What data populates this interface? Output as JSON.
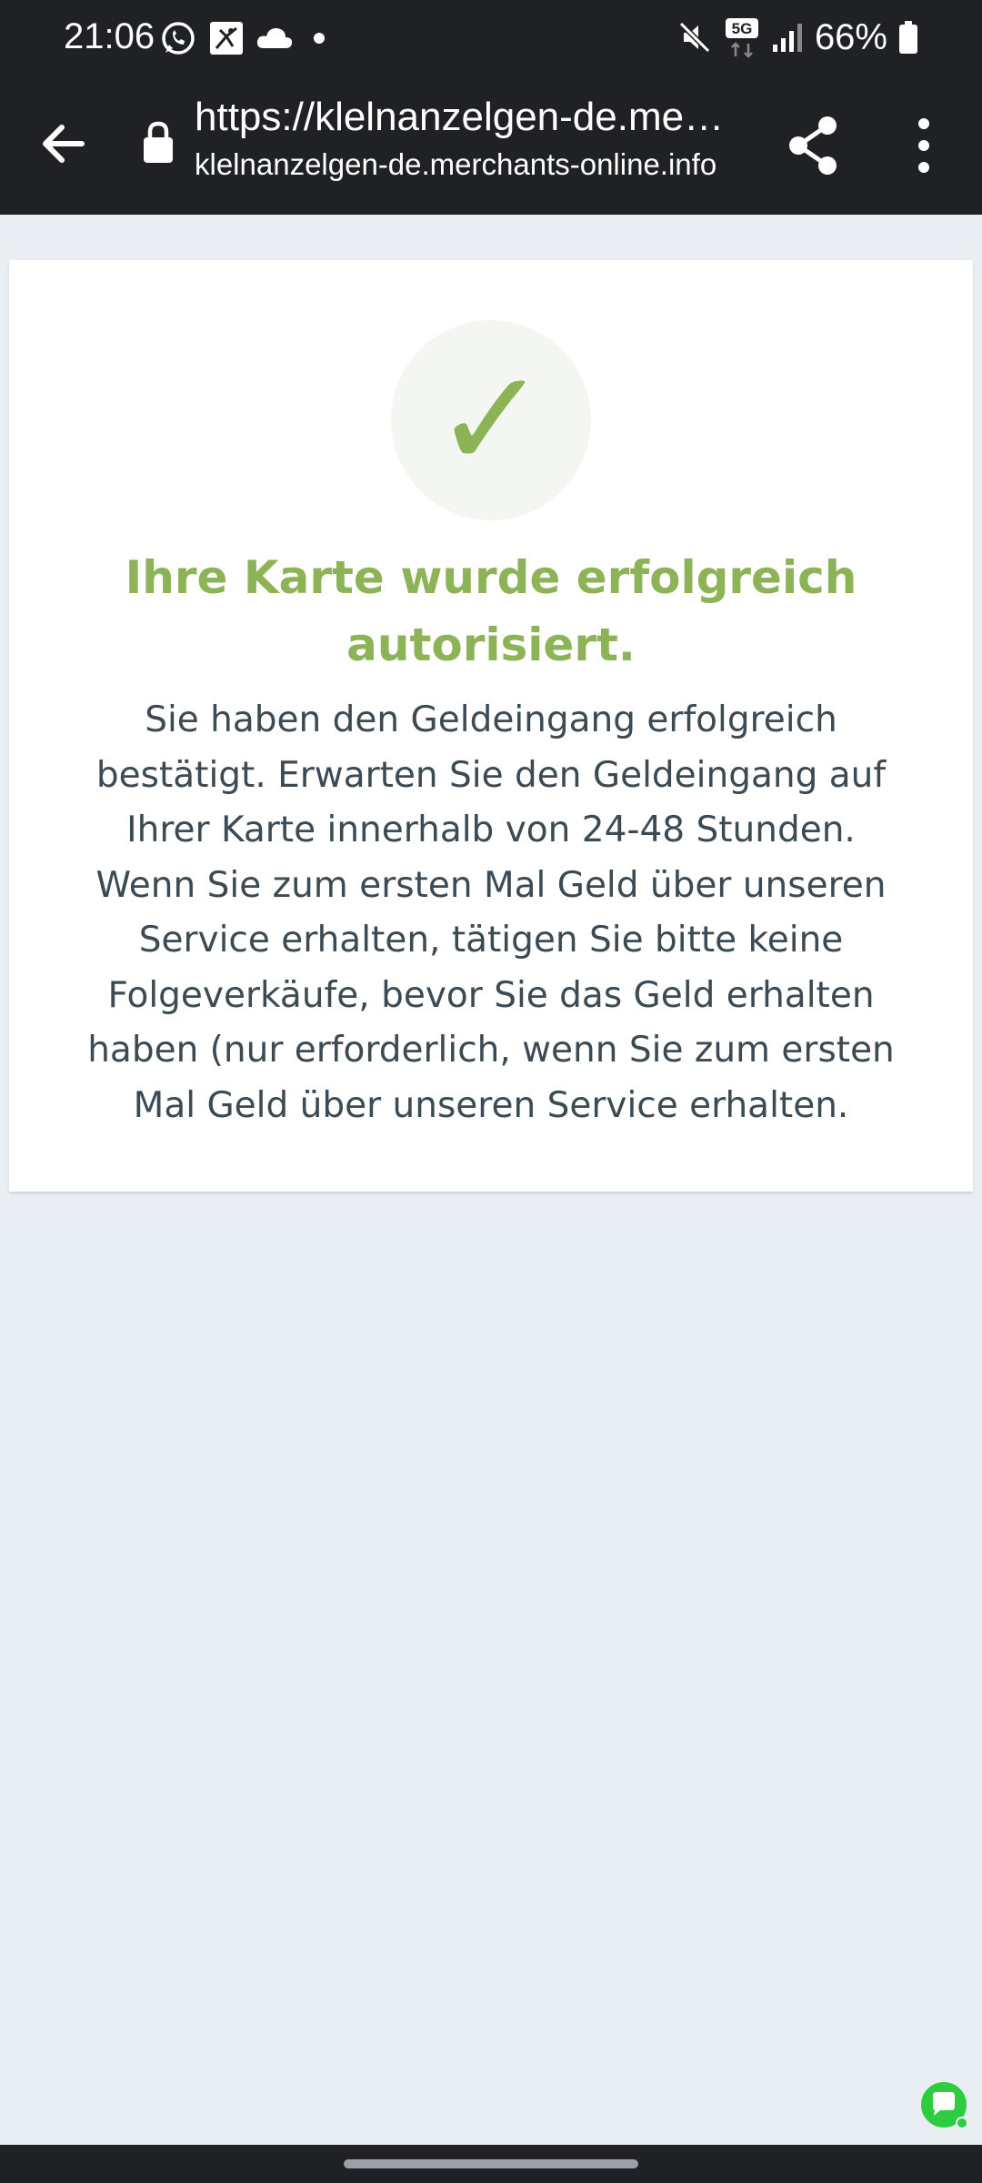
{
  "status_bar": {
    "time": "21:06",
    "network": "5G",
    "battery": "66%"
  },
  "browser": {
    "url_title": "https://klelnanzelgen-de.me…",
    "url_domain": "klelnanzelgen-de.merchants-online.info"
  },
  "card": {
    "title": "Ihre Karte wurde erfolgreich autorisiert.",
    "message": "Sie haben den Geldeingang erfolgreich bestätigt. Erwarten Sie den Geldeingang auf Ihrer Karte innerhalb von 24-48 Stunden. Wenn Sie zum ersten Mal Geld über unseren Service erhalten, tätigen Sie bitte keine Folgeverkäufe, bevor Sie das Geld erhalten haben (nur erforderlich, wenn Sie zum ersten Mal Geld über unseren Service erhalten.",
    "check_symbol": "✓"
  },
  "colors": {
    "accent_green": "#8db357",
    "chrome_dark": "#202124",
    "page_bg": "#e9eef2",
    "text_body": "#3c4a54",
    "chat_green": "#2ecc40"
  },
  "icons": {
    "status_left": [
      "whatsapp-icon",
      "app-icon",
      "cloud-icon",
      "dot-icon"
    ],
    "status_right": [
      "mute-icon",
      "network-5g-icon",
      "signal-icon",
      "battery-icon"
    ],
    "toolbar": [
      "back-arrow-icon",
      "lock-icon",
      "share-icon",
      "more-vert-icon"
    ],
    "floating": [
      "chat-icon"
    ]
  }
}
